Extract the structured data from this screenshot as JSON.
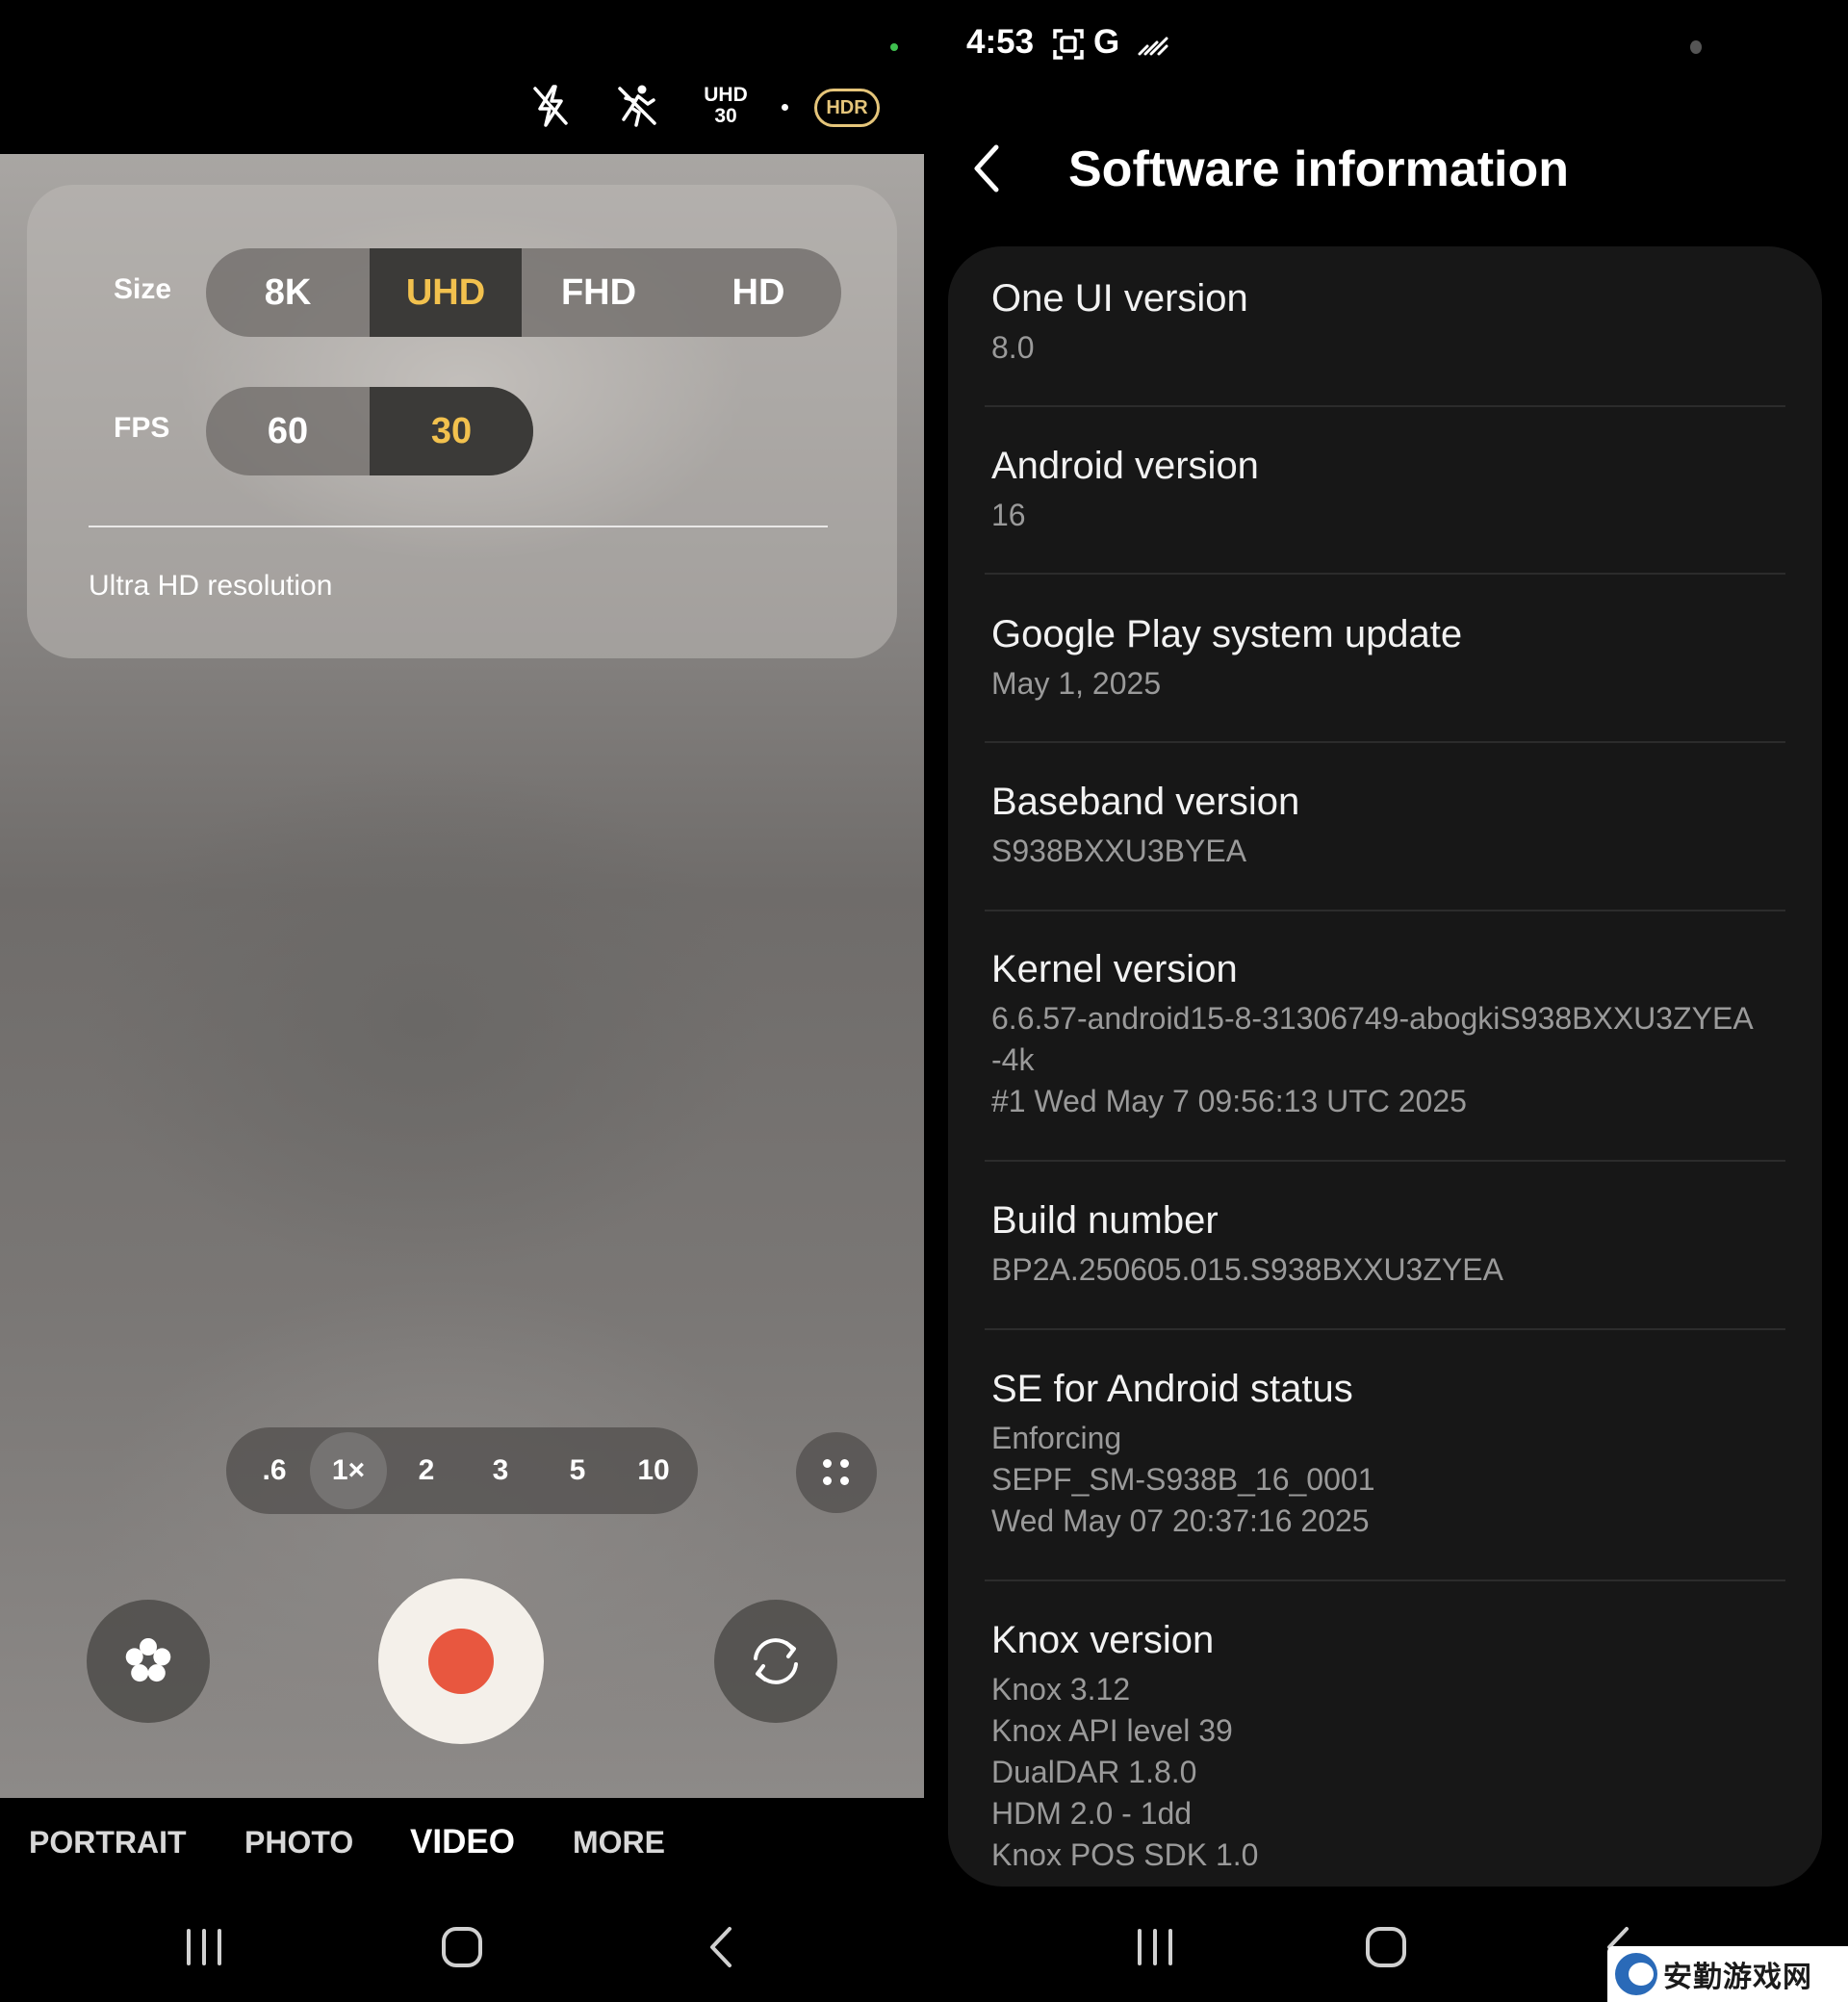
{
  "camera": {
    "status": {
      "resolution": "UHD",
      "fps": "30",
      "hdr": "HDR"
    },
    "panel": {
      "size_label": "Size",
      "size_options": [
        "8K",
        "UHD",
        "FHD",
        "HD"
      ],
      "size_selected": "UHD",
      "fps_label": "FPS",
      "fps_options": [
        "60",
        "30"
      ],
      "fps_selected": "30",
      "caption": "Ultra HD resolution"
    },
    "zoom_levels": [
      ".6",
      "1×",
      "2",
      "3",
      "5",
      "10"
    ],
    "zoom_selected": "1×",
    "modes": [
      "PORTRAIT",
      "PHOTO",
      "VIDEO",
      "MORE"
    ],
    "mode_selected": "VIDEO",
    "accent_color": "#f2c14e",
    "record_color": "#e8573f"
  },
  "settings": {
    "status_time": "4:53",
    "status_carrier": "G",
    "title": "Software information",
    "items": [
      {
        "title": "One UI version",
        "values": [
          "8.0"
        ]
      },
      {
        "title": "Android version",
        "values": [
          "16"
        ]
      },
      {
        "title": "Google Play system update",
        "values": [
          "May 1, 2025"
        ]
      },
      {
        "title": "Baseband version",
        "values": [
          "S938BXXU3BYEA"
        ]
      },
      {
        "title": "Kernel version",
        "values": [
          "6.6.57-android15-8-31306749-abogkiS938BXXU3ZYEA",
          "-4k",
          "#1 Wed May  7 09:56:13 UTC 2025"
        ]
      },
      {
        "title": "Build number",
        "values": [
          "BP2A.250605.015.S938BXXU3ZYEA"
        ]
      },
      {
        "title": "SE for Android status",
        "values": [
          "Enforcing",
          "SEPF_SM-S938B_16_0001",
          "Wed May 07 20:37:16 2025"
        ]
      },
      {
        "title": "Knox version",
        "values": [
          "Knox 3.12",
          "Knox API level 39",
          "DualDAR 1.8.0",
          "HDM 2.0 - 1dd",
          "Knox POS SDK 1.0"
        ]
      }
    ]
  },
  "watermark": {
    "text": "安勤游戏网"
  }
}
